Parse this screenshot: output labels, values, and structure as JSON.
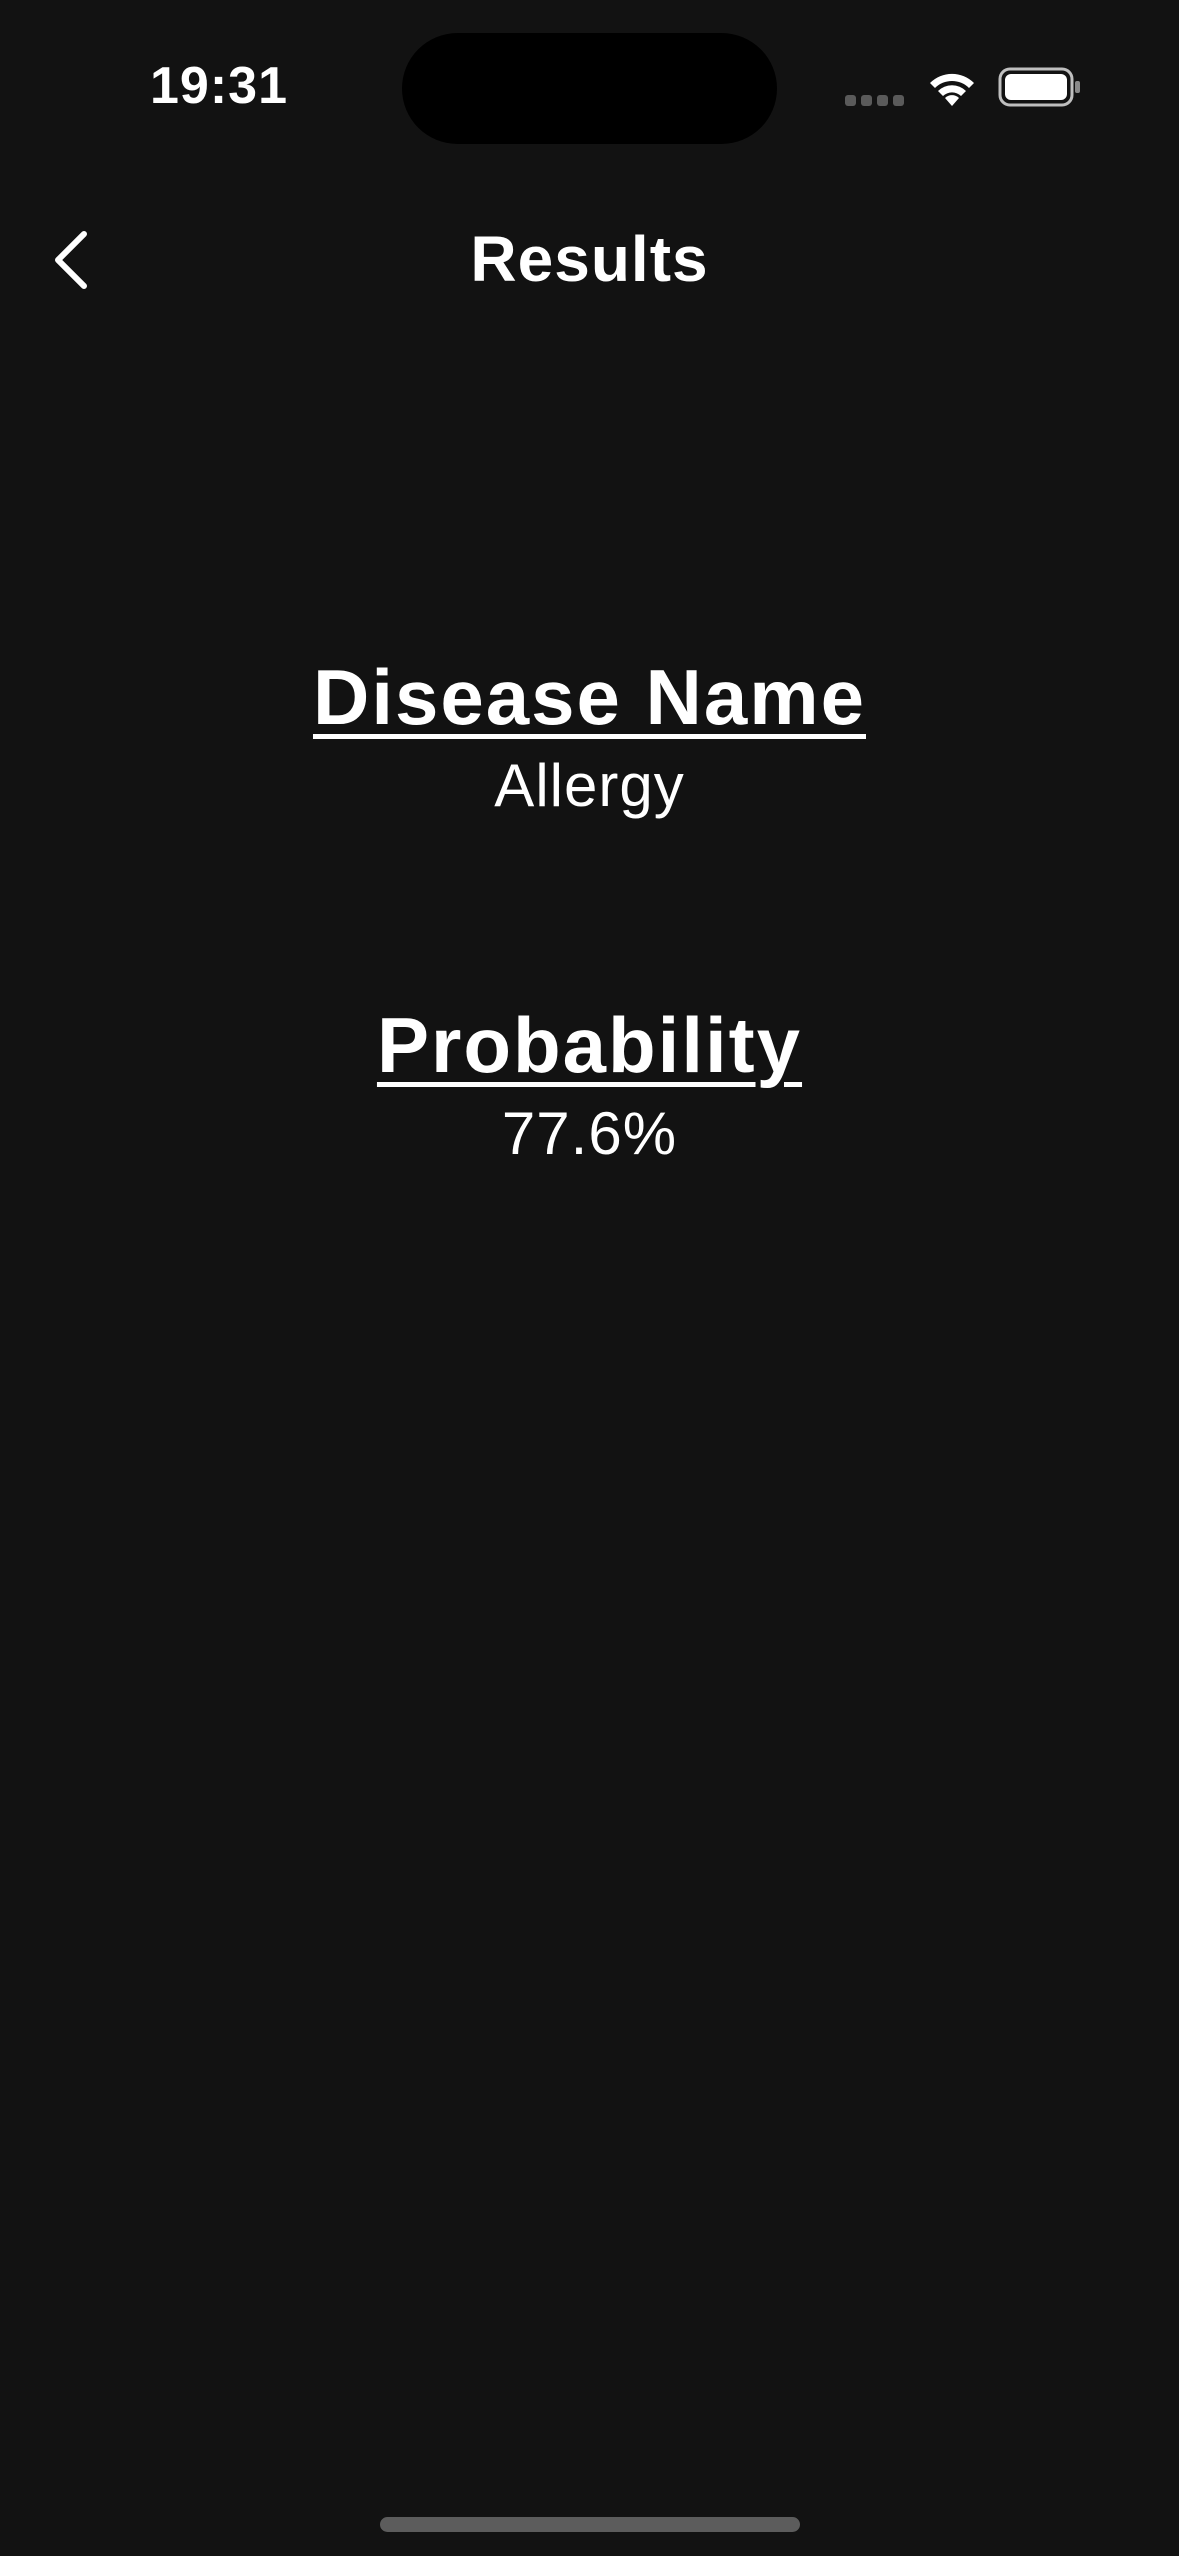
{
  "status_bar": {
    "time": "19:31"
  },
  "nav": {
    "title": "Results",
    "back_icon": "chevron-left-icon"
  },
  "results": {
    "disease_heading": "Disease Name",
    "disease_value": "Allergy",
    "probability_heading": "Probability",
    "probability_value": "77.6%"
  },
  "colors": {
    "background": "#121212",
    "text": "#ffffff",
    "home_indicator": "#5c5c5c"
  }
}
